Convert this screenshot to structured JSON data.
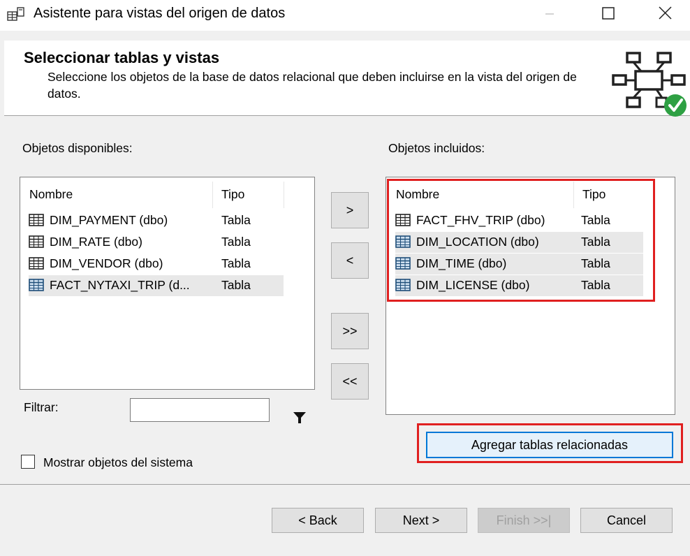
{
  "window": {
    "title": "Asistente para vistas del origen de datos",
    "controls": [
      "minimize-icon",
      "maximize-icon",
      "close-icon"
    ]
  },
  "header": {
    "heading": "Seleccionar tablas y vistas",
    "description": "Seleccione los objetos de la base de datos relacional que deben incluirse en la vista del origen de datos."
  },
  "available": {
    "label": "Objetos disponibles:",
    "columns": [
      "Nombre",
      "Tipo"
    ],
    "rows": [
      {
        "name": "DIM_PAYMENT (dbo)",
        "type": "Tabla"
      },
      {
        "name": "DIM_RATE (dbo)",
        "type": "Tabla"
      },
      {
        "name": "DIM_VENDOR (dbo)",
        "type": "Tabla"
      },
      {
        "name": "FACT_NYTAXI_TRIP (d...",
        "type": "Tabla",
        "selected": true
      }
    ]
  },
  "included": {
    "label": "Objetos incluidos:",
    "columns": [
      "Nombre",
      "Tipo"
    ],
    "rows": [
      {
        "name": "FACT_FHV_TRIP (dbo)",
        "type": "Tabla"
      },
      {
        "name": "DIM_LOCATION (dbo)",
        "type": "Tabla",
        "selected": true
      },
      {
        "name": "DIM_TIME (dbo)",
        "type": "Tabla",
        "selected": true
      },
      {
        "name": "DIM_LICENSE (dbo)",
        "type": "Tabla",
        "selected": true
      }
    ]
  },
  "transfer": {
    "add_one": ">",
    "remove_one": "<",
    "add_all": ">>",
    "remove_all": "<<"
  },
  "filter": {
    "label": "Filtrar:",
    "value": ""
  },
  "show_system": {
    "label": "Mostrar objetos del sistema",
    "checked": false
  },
  "add_related_label": "Agregar tablas relacionadas",
  "footer": {
    "back": "< Back",
    "next": "Next >",
    "finish": "Finish >>|",
    "cancel": "Cancel"
  },
  "colors": {
    "highlight_box": "#e02020",
    "focus_border": "#0078d7",
    "check_badge": "#2ea043"
  }
}
